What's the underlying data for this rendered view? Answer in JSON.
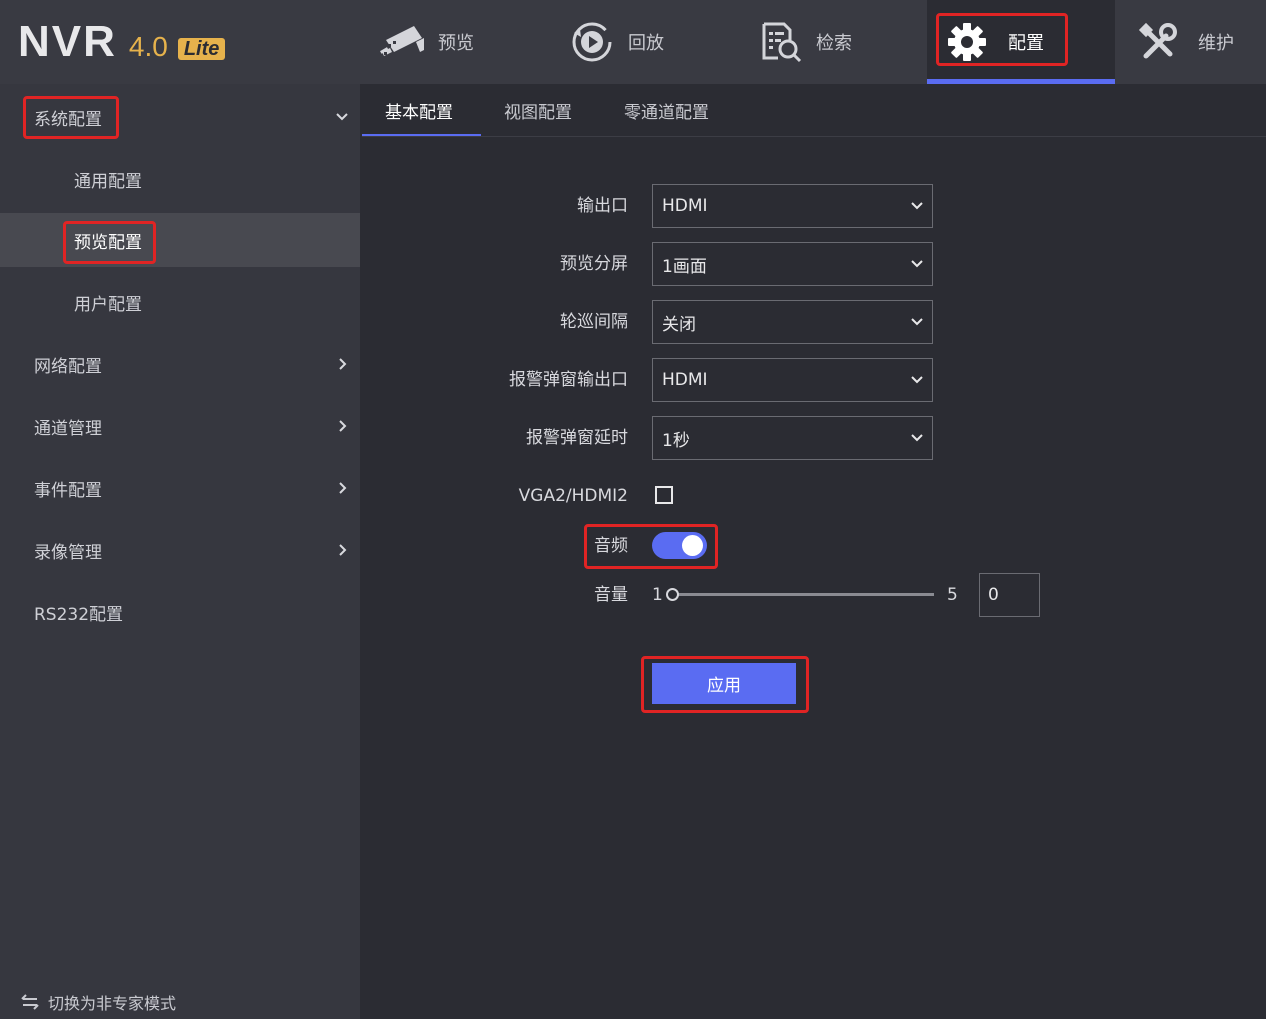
{
  "app": {
    "logo_text": "NVR",
    "version": "4.0",
    "edition": "Lite"
  },
  "nav": {
    "preview": "预览",
    "playback": "回放",
    "search": "检索",
    "config": "配置",
    "maintenance": "维护",
    "active": "config"
  },
  "sidebar": {
    "system_config": "系统配置",
    "general_config": "通用配置",
    "preview_config": "预览配置",
    "user_config": "用户配置",
    "network_config": "网络配置",
    "channel_mgmt": "通道管理",
    "event_config": "事件配置",
    "record_mgmt": "录像管理",
    "rs232_config": "RS232配置",
    "mode_switch": "切换为非专家模式"
  },
  "tabs": {
    "basic": "基本配置",
    "view": "视图配置",
    "zero_channel": "零通道配置"
  },
  "form": {
    "output_label": "输出口",
    "output_value": "HDMI",
    "split_label": "预览分屏",
    "split_value": "1画面",
    "patrol_label": "轮巡间隔",
    "patrol_value": "关闭",
    "alarm_output_label": "报警弹窗输出口",
    "alarm_output_value": "HDMI",
    "alarm_delay_label": "报警弹窗延时",
    "alarm_delay_value": "1秒",
    "vga_label": "VGA2/HDMI2",
    "vga_checked": false,
    "audio_label": "音频",
    "audio_on": true,
    "volume_label": "音量",
    "volume_min": "1",
    "volume_max": "5",
    "volume_input": "0",
    "apply_label": "应用"
  },
  "colors": {
    "accent": "#5a6cf2",
    "highlight": "#e02424",
    "brand": "#e6b24c"
  }
}
